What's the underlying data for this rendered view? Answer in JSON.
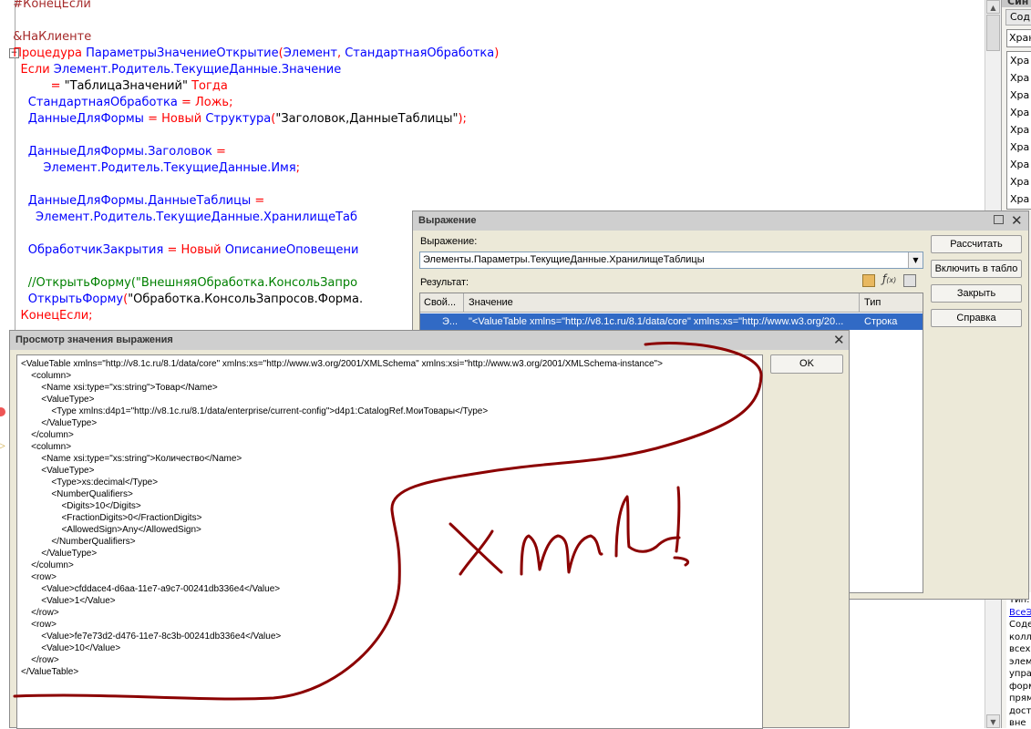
{
  "code": {
    "lines": [
      {
        "parts": [
          {
            "t": "  #КонецЕсли",
            "c": "brown"
          }
        ]
      },
      {
        "parts": [
          {
            "t": "",
            "c": "blk"
          }
        ]
      },
      {
        "parts": [
          {
            "t": "  &НаКлиенте",
            "c": "brown"
          }
        ]
      },
      {
        "parts": [
          {
            "t": "  Процедура ",
            "c": "red"
          },
          {
            "t": "ПараметрыЗначениеОткрытие",
            "c": "blue"
          },
          {
            "t": "(",
            "c": "red"
          },
          {
            "t": "Элемент",
            "c": "blue"
          },
          {
            "t": ", ",
            "c": "red"
          },
          {
            "t": "СтандартнаяОбработка",
            "c": "blue"
          },
          {
            "t": ")",
            "c": "red"
          }
        ]
      },
      {
        "parts": [
          {
            "t": "    Если ",
            "c": "red"
          },
          {
            "t": "Элемент.Родитель.ТекущиеДанные.Значение",
            "c": "blue"
          }
        ]
      },
      {
        "parts": [
          {
            "t": "            = ",
            "c": "red"
          },
          {
            "t": "\"ТаблицаЗначений\"",
            "c": "blk"
          },
          {
            "t": " Тогда",
            "c": "red"
          }
        ]
      },
      {
        "parts": [
          {
            "t": "      СтандартнаяОбработка ",
            "c": "blue"
          },
          {
            "t": "= Ложь;",
            "c": "red"
          }
        ]
      },
      {
        "parts": [
          {
            "t": "      ДанныеДляФормы ",
            "c": "blue"
          },
          {
            "t": "= Новый ",
            "c": "red"
          },
          {
            "t": "Структура",
            "c": "blue"
          },
          {
            "t": "(",
            "c": "red"
          },
          {
            "t": "\"Заголовок,ДанныеТаблицы\"",
            "c": "blk"
          },
          {
            "t": ");",
            "c": "red"
          }
        ]
      },
      {
        "parts": [
          {
            "t": "",
            "c": "blk"
          }
        ]
      },
      {
        "parts": [
          {
            "t": "      ДанныеДляФормы.Заголовок ",
            "c": "blue"
          },
          {
            "t": "=",
            "c": "red"
          }
        ]
      },
      {
        "parts": [
          {
            "t": "          Элемент.Родитель.ТекущиеДанные.Имя",
            "c": "blue"
          },
          {
            "t": ";",
            "c": "red"
          }
        ]
      },
      {
        "parts": [
          {
            "t": "",
            "c": "blk"
          }
        ]
      },
      {
        "parts": [
          {
            "t": "      ДанныеДляФормы.ДанныеТаблицы ",
            "c": "blue"
          },
          {
            "t": "=",
            "c": "red"
          }
        ]
      },
      {
        "parts": [
          {
            "t": "        Элемент.Родитель.ТекущиеДанные.ХранилищеТаб",
            "c": "blue"
          }
        ]
      },
      {
        "parts": [
          {
            "t": "",
            "c": "blk"
          }
        ]
      },
      {
        "parts": [
          {
            "t": "      ОбработчикЗакрытия ",
            "c": "blue"
          },
          {
            "t": "= Новый ",
            "c": "red"
          },
          {
            "t": "ОписаниеОповещени",
            "c": "blue"
          }
        ]
      },
      {
        "parts": [
          {
            "t": "",
            "c": "blk"
          }
        ]
      },
      {
        "parts": [
          {
            "t": "      //ОткрытьФорму(\"ВнешняяОбработка.КонсольЗапро",
            "c": "cmt"
          }
        ]
      },
      {
        "parts": [
          {
            "t": "      ОткрытьФорму",
            "c": "blue"
          },
          {
            "t": "(",
            "c": "red"
          },
          {
            "t": "\"Обработка.КонсольЗапросов.Форма.",
            "c": "blk"
          }
        ]
      },
      {
        "parts": [
          {
            "t": "    КонецЕсли;",
            "c": "red"
          }
        ]
      }
    ]
  },
  "right_panel": {
    "header": "Син",
    "tab": "Сод",
    "input": "Хран",
    "items": [
      "Хра",
      "Хра",
      "Хра",
      "Хра",
      "Хра",
      "Хра",
      "Хра",
      "Хра",
      "Хра"
    ],
    "bottom_lines": [
      {
        "t": "Тип:",
        "link": false
      },
      {
        "t": "ВсеЭ",
        "link": true
      },
      {
        "t": "Соде",
        "link": false
      },
      {
        "t": "колл",
        "link": false
      },
      {
        "t": "всех",
        "link": false
      },
      {
        "t": "элем",
        "link": false
      },
      {
        "t": "упра",
        "link": false
      },
      {
        "t": "форм",
        "link": false
      },
      {
        "t": "прям",
        "link": false
      },
      {
        "t": "дост",
        "link": false
      },
      {
        "t": "вне",
        "link": false
      }
    ]
  },
  "expr_window": {
    "title": "Выражение",
    "expr_label": "Выражение:",
    "expr_value": "Элементы.Параметры.ТекущиеДанные.ХранилищеТаблицы",
    "result_label": "Результат:",
    "columns": [
      "Свой...",
      "Значение",
      "Тип"
    ],
    "row": {
      "prop": "Э...",
      "value": "\"<ValueTable xmlns=\"http://v8.1c.ru/8.1/data/core\" xmlns:xs=\"http://www.w3.org/20...",
      "type": "Строка"
    },
    "buttons": [
      "Рассчитать",
      "Включить в табло",
      "Закрыть",
      "Справка"
    ]
  },
  "view_window": {
    "title": "Просмотр значения выражения",
    "ok_label": "OK",
    "xml_lines": [
      "<ValueTable xmlns=\"http://v8.1c.ru/8.1/data/core\" xmlns:xs=\"http://www.w3.org/2001/XMLSchema\" xmlns:xsi=\"http://www.w3.org/2001/XMLSchema-instance\">",
      "    <column>",
      "        <Name xsi:type=\"xs:string\">Товар</Name>",
      "        <ValueType>",
      "            <Type xmlns:d4p1=\"http://v8.1c.ru/8.1/data/enterprise/current-config\">d4p1:CatalogRef.МоиТовары</Type>",
      "        </ValueType>",
      "    </column>",
      "    <column>",
      "        <Name xsi:type=\"xs:string\">Количество</Name>",
      "        <ValueType>",
      "            <Type>xs:decimal</Type>",
      "            <NumberQualifiers>",
      "                <Digits>10</Digits>",
      "                <FractionDigits>0</FractionDigits>",
      "                <AllowedSign>Any</AllowedSign>",
      "            </NumberQualifiers>",
      "        </ValueType>",
      "    </column>",
      "    <row>",
      "        <Value>cfddace4-d6aa-11e7-a9c7-00241db336e4</Value>",
      "        <Value>1</Value>",
      "    </row>",
      "    <row>",
      "        <Value>fe7e73d2-d476-11e7-8c3b-00241db336e4</Value>",
      "        <Value>10</Value>",
      "    </row>",
      "</ValueTable>"
    ]
  },
  "colors": {
    "code_keyword": "#ff0000",
    "code_ident": "#0000ff",
    "selection": "#316ac5",
    "ink": "#8b0000"
  }
}
